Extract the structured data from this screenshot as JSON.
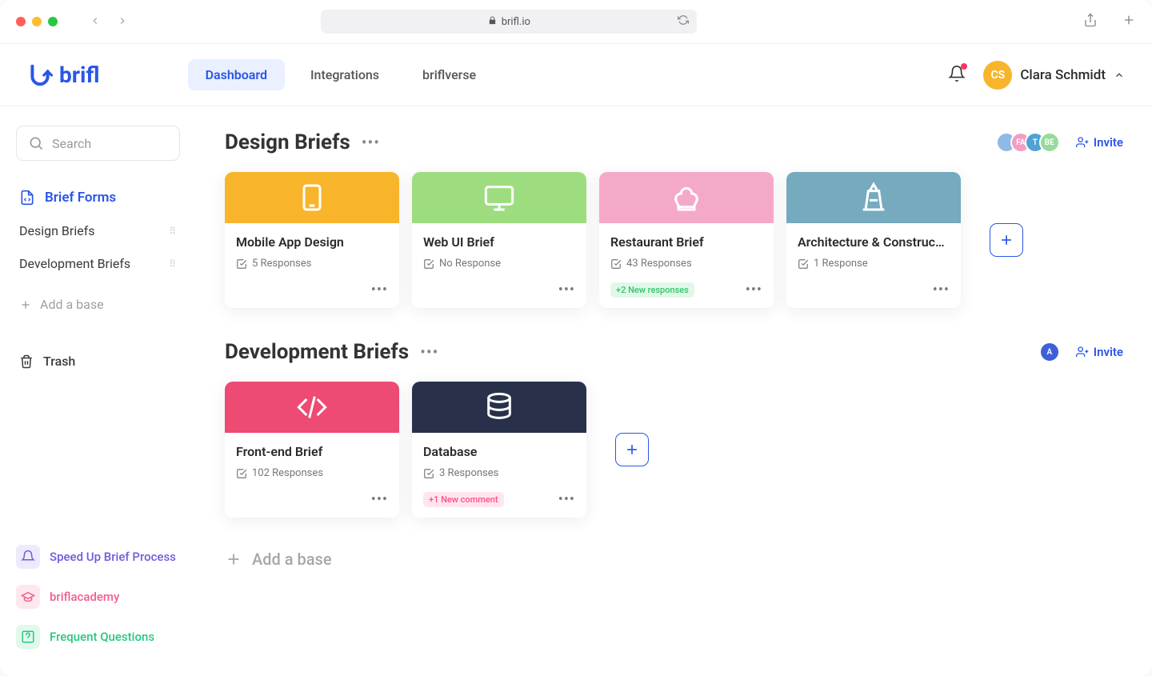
{
  "url": "brifl.io",
  "logo_text": "brifl",
  "tabs": [
    "Dashboard",
    "Integrations",
    "briflverse"
  ],
  "active_tab": 0,
  "user": {
    "initials": "CS",
    "name": "Clara Schmidt"
  },
  "sidebar": {
    "search_placeholder": "Search",
    "primary": "Brief Forms",
    "items": [
      "Design Briefs",
      "Development Briefs"
    ],
    "add_base": "Add a base",
    "trash": "Trash",
    "footer": [
      {
        "label": "Speed Up Brief Process",
        "color": "#6c5ce0",
        "bg": "#eeeafc"
      },
      {
        "label": "briflacademy",
        "color": "#f05f8b",
        "bg": "#ffe7ee"
      },
      {
        "label": "Frequent Questions",
        "color": "#29c77e",
        "bg": "#e1f8ec"
      }
    ]
  },
  "sections": [
    {
      "title": "Design Briefs",
      "collaborators": [
        {
          "label": "",
          "color": "#8fb9e6"
        },
        {
          "label": "FA",
          "color": "#f49cc2"
        },
        {
          "label": "T",
          "color": "#4fa2d6"
        },
        {
          "label": "BE",
          "color": "#97db9b"
        }
      ],
      "invite": "Invite",
      "cards": [
        {
          "title": "Mobile App Design",
          "responses": "5 Responses",
          "color": "#f8b52b",
          "icon": "tablet"
        },
        {
          "title": "Web UI Brief",
          "responses": "No Response",
          "color": "#9edd7f",
          "icon": "monitor"
        },
        {
          "title": "Restaurant Brief",
          "responses": "43 Responses",
          "color": "#f5a9c9",
          "icon": "chef",
          "pill": {
            "text": "+2 New responses",
            "type": "green"
          }
        },
        {
          "title": "Architecture & Construc…",
          "responses": "1 Response",
          "color": "#75aabf",
          "icon": "tower"
        }
      ]
    },
    {
      "title": "Development Briefs",
      "collaborators": [
        {
          "label": "A",
          "color": "#3e5fd9"
        }
      ],
      "invite": "Invite",
      "cards": [
        {
          "title": "Front-end Brief",
          "responses": "102 Responses",
          "color": "#ed4a74",
          "icon": "code"
        },
        {
          "title": "Database",
          "responses": "3 Responses",
          "color": "#29304a",
          "icon": "database",
          "pill": {
            "text": "+1 New comment",
            "type": "pink"
          }
        }
      ]
    }
  ],
  "add_base_main": "Add a base"
}
